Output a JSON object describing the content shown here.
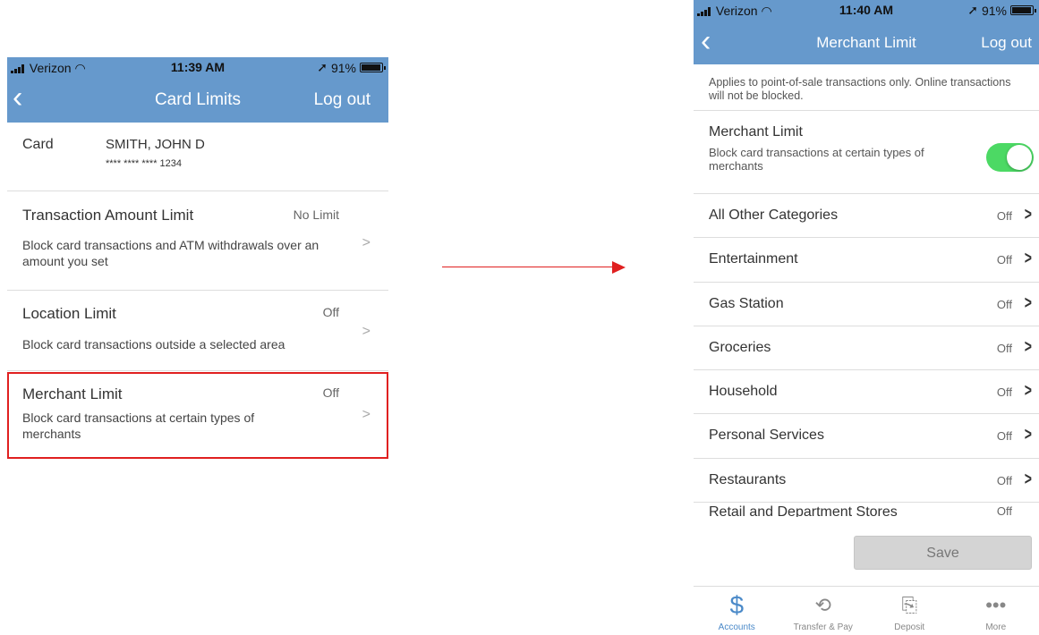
{
  "left_screen": {
    "status": {
      "carrier": "Verizon",
      "time": "11:39 AM",
      "battery": "91%"
    },
    "nav": {
      "title": "Card Limits",
      "logout": "Log out"
    },
    "card": {
      "label": "Card",
      "name": "SMITH, JOHN D",
      "number": "**** **** **** 1234"
    },
    "limits": [
      {
        "title": "Transaction Amount Limit",
        "value": "No Limit",
        "desc": "Block card transactions and ATM withdrawals over an amount you set"
      },
      {
        "title": "Location Limit",
        "value": "Off",
        "desc": "Block card transactions outside a selected area"
      },
      {
        "title": "Merchant Limit",
        "value": "Off",
        "desc": "Block card transactions at certain types of merchants"
      }
    ]
  },
  "right_screen": {
    "status": {
      "carrier": "Verizon",
      "time": "11:40 AM",
      "battery": "91%"
    },
    "nav": {
      "title": "Merchant Limit",
      "logout": "Log out"
    },
    "notice": "Applies to point-of-sale transactions only. Online transactions will not be blocked.",
    "merchant_toggle": {
      "title": "Merchant Limit",
      "desc": "Block card transactions at certain types of merchants",
      "on": true
    },
    "categories": [
      {
        "name": "All Other Categories",
        "value": "Off"
      },
      {
        "name": "Entertainment",
        "value": "Off"
      },
      {
        "name": "Gas Station",
        "value": "Off"
      },
      {
        "name": "Groceries",
        "value": "Off"
      },
      {
        "name": "Household",
        "value": "Off"
      },
      {
        "name": "Personal Services",
        "value": "Off"
      },
      {
        "name": "Restaurants",
        "value": "Off"
      },
      {
        "name": "Retail and Department Stores",
        "value": "Off"
      }
    ],
    "save_label": "Save",
    "tabs": [
      {
        "label": "Accounts",
        "icon": "dollar-icon"
      },
      {
        "label": "Transfer & Pay",
        "icon": "transfer-icon"
      },
      {
        "label": "Deposit",
        "icon": "deposit-icon"
      },
      {
        "label": "More",
        "icon": "more-icon"
      }
    ]
  },
  "colors": {
    "header": "#6699cc",
    "highlight": "#e02020",
    "toggle_on": "#4cd964",
    "active_tab": "#4a89c8"
  }
}
